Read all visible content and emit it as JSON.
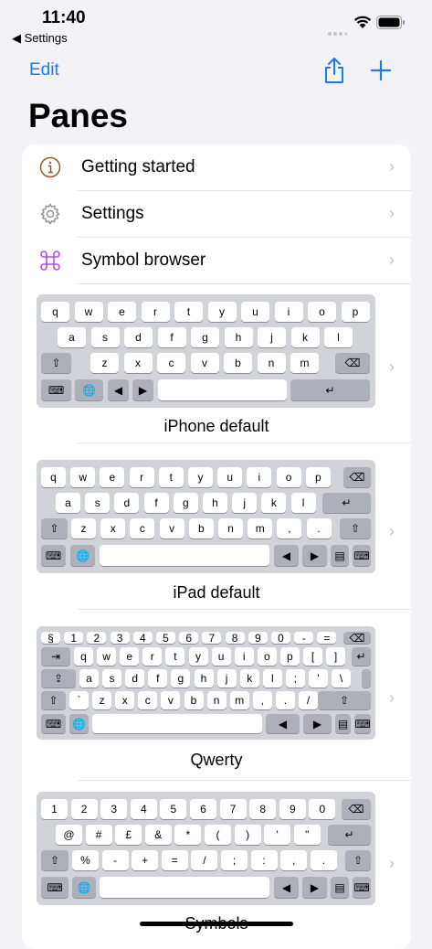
{
  "status": {
    "time": "11:40",
    "back": "◀ Settings"
  },
  "nav": {
    "edit": "Edit",
    "share_icon": "share-icon",
    "add_icon": "plus-icon"
  },
  "page": {
    "title": "Panes"
  },
  "menu": [
    {
      "label": "Getting started",
      "icon": "info-icon"
    },
    {
      "label": "Settings",
      "icon": "gear-icon"
    },
    {
      "label": "Symbol browser",
      "icon": "command-icon"
    }
  ],
  "keyboards": [
    {
      "label": "iPhone default"
    },
    {
      "label": "iPad default"
    },
    {
      "label": "Qwerty"
    },
    {
      "label": "Symbols"
    }
  ],
  "keys": {
    "iphone_row1": [
      "q",
      "w",
      "e",
      "r",
      "t",
      "y",
      "u",
      "i",
      "o",
      "p"
    ],
    "iphone_row2": [
      "a",
      "s",
      "d",
      "f",
      "g",
      "h",
      "j",
      "k",
      "l"
    ],
    "iphone_row3": [
      "z",
      "x",
      "c",
      "v",
      "b",
      "n",
      "m"
    ],
    "ipad_row1": [
      "q",
      "w",
      "e",
      "r",
      "t",
      "y",
      "u",
      "i",
      "o",
      "p"
    ],
    "ipad_row2": [
      "a",
      "s",
      "d",
      "f",
      "g",
      "h",
      "j",
      "k",
      "l"
    ],
    "ipad_row3": [
      "z",
      "x",
      "c",
      "v",
      "b",
      "n",
      "m",
      ",",
      "."
    ],
    "qwerty_row0": [
      "§",
      "1",
      "2",
      "3",
      "4",
      "5",
      "6",
      "7",
      "8",
      "9",
      "0",
      "-",
      "="
    ],
    "qwerty_row1": [
      "q",
      "w",
      "e",
      "r",
      "t",
      "y",
      "u",
      "i",
      "o",
      "p",
      "[",
      "]"
    ],
    "qwerty_row2": [
      "a",
      "s",
      "d",
      "f",
      "g",
      "h",
      "j",
      "k",
      "l",
      ";",
      "'",
      "\\"
    ],
    "qwerty_row3": [
      "`",
      "z",
      "x",
      "c",
      "v",
      "b",
      "n",
      "m",
      ",",
      ".",
      "/"
    ],
    "sym_row1": [
      "1",
      "2",
      "3",
      "4",
      "5",
      "6",
      "7",
      "8",
      "9",
      "0"
    ],
    "sym_row2": [
      "@",
      "#",
      "£",
      "&",
      "*",
      "(",
      ")",
      "'",
      "\""
    ],
    "sym_row3": [
      "%",
      "-",
      "+",
      "=",
      "/",
      ";",
      ":",
      ",",
      "."
    ]
  }
}
